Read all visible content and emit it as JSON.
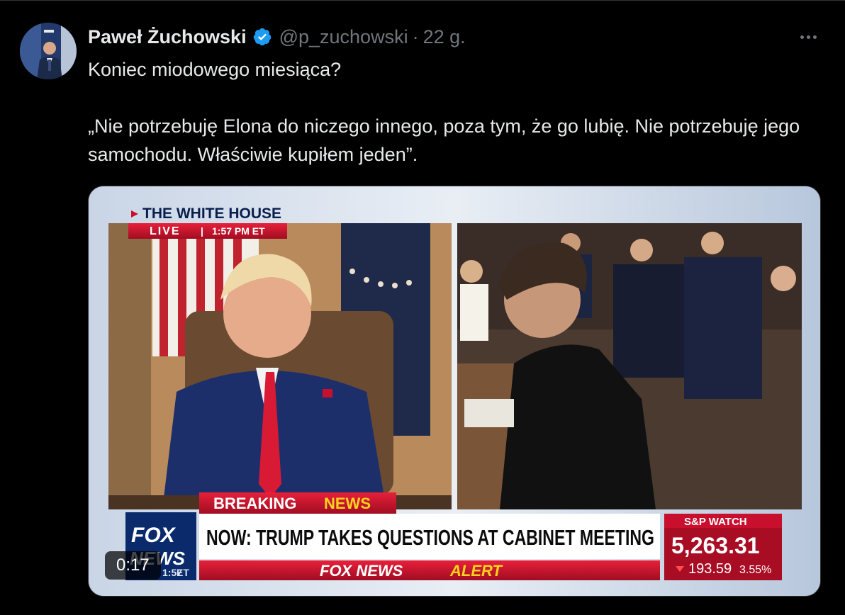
{
  "tweet": {
    "author_name": "Paweł Żuchowski",
    "handle": "@p_zuchowski",
    "time": "22 g.",
    "line1": "Koniec miodowego miesiąca?",
    "line2": " „Nie potrzebuję Elona do niczego innego, poza tym, że go lubię. Nie potrzebuję jego samochodu. Właściwie kupiłem jeden”."
  },
  "video": {
    "duration_label": "0:17",
    "location": "THE WHITE HOUSE",
    "live_label": "LIVE",
    "live_time": "1:57 PM ET",
    "breaking_word1": "BREAKING",
    "breaking_word2": "NEWS",
    "headline": "NOW: TRUMP TAKES QUESTIONS AT CABINET MEETING",
    "alert_word1": "FOX NEWS",
    "alert_word2": "ALERT",
    "logo_top": "FOX",
    "logo_bottom": "NEWS",
    "corner_et": "ET",
    "corner_time": "1:57",
    "sp_title": "S&P WATCH",
    "sp_value": "5,263.31",
    "sp_change": "193.59",
    "sp_percent": "3.55%"
  },
  "colors": {
    "background": "#000000",
    "verified": "#1d9bf0",
    "fox_red": "#c8102e",
    "fox_blue": "#0a2a6c"
  }
}
